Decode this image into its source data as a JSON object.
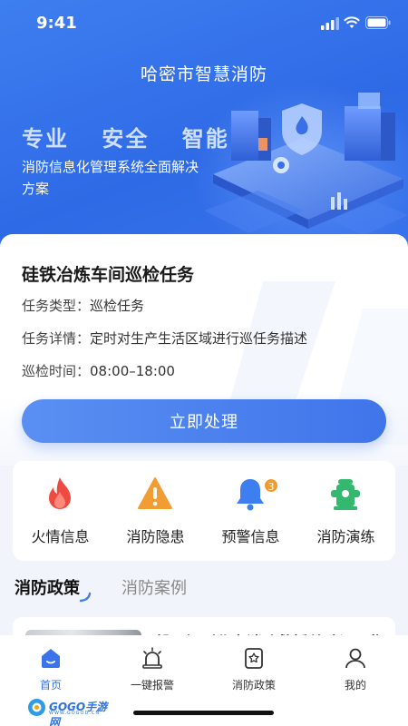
{
  "status_bar": {
    "time": "9:41"
  },
  "hero": {
    "app_title": "哈密市智慧消防",
    "slogan": [
      "专业",
      "安全",
      "智能"
    ],
    "description": "消防信息化管理系统全面解决方案"
  },
  "task": {
    "title": "硅铁冶炼车间巡检任务",
    "type_label": "任务类型：",
    "type_value": "巡检任务",
    "detail_label": "任务详情：",
    "detail_value": "定时对生产生活区域进行巡任务描述",
    "time_label": "巡检时间：",
    "time_value": "08:00–18:00",
    "action_label": "立即处理"
  },
  "quick_actions": [
    {
      "label": "火情信息",
      "icon": "flame-icon",
      "color": "#ef4a3f"
    },
    {
      "label": "消防隐患",
      "icon": "warning-triangle-icon",
      "color": "#f29c34"
    },
    {
      "label": "预警信息",
      "icon": "bell-icon",
      "color": "#3d7ef0",
      "badge": "3"
    },
    {
      "label": "消防演练",
      "icon": "hydrant-icon",
      "color": "#34b76e"
    }
  ],
  "tabs": {
    "active": "消防政策",
    "inactive": "消防案例"
  },
  "article": {
    "title": "郝军辉到北京消防救援总队调研指"
  },
  "bottom_nav": [
    {
      "label": "首页",
      "icon": "home-icon",
      "active": true
    },
    {
      "label": "一键报警",
      "icon": "alarm-icon",
      "active": false
    },
    {
      "label": "消防政策",
      "icon": "policy-icon",
      "active": false
    },
    {
      "label": "我的",
      "icon": "user-icon",
      "active": false
    }
  ],
  "watermark": {
    "text": "GOGO手游网",
    "sub": "WWW.GOGOD.CN"
  },
  "colors": {
    "primary": "#3f75ea",
    "hero_top": "#3d7ef0"
  }
}
